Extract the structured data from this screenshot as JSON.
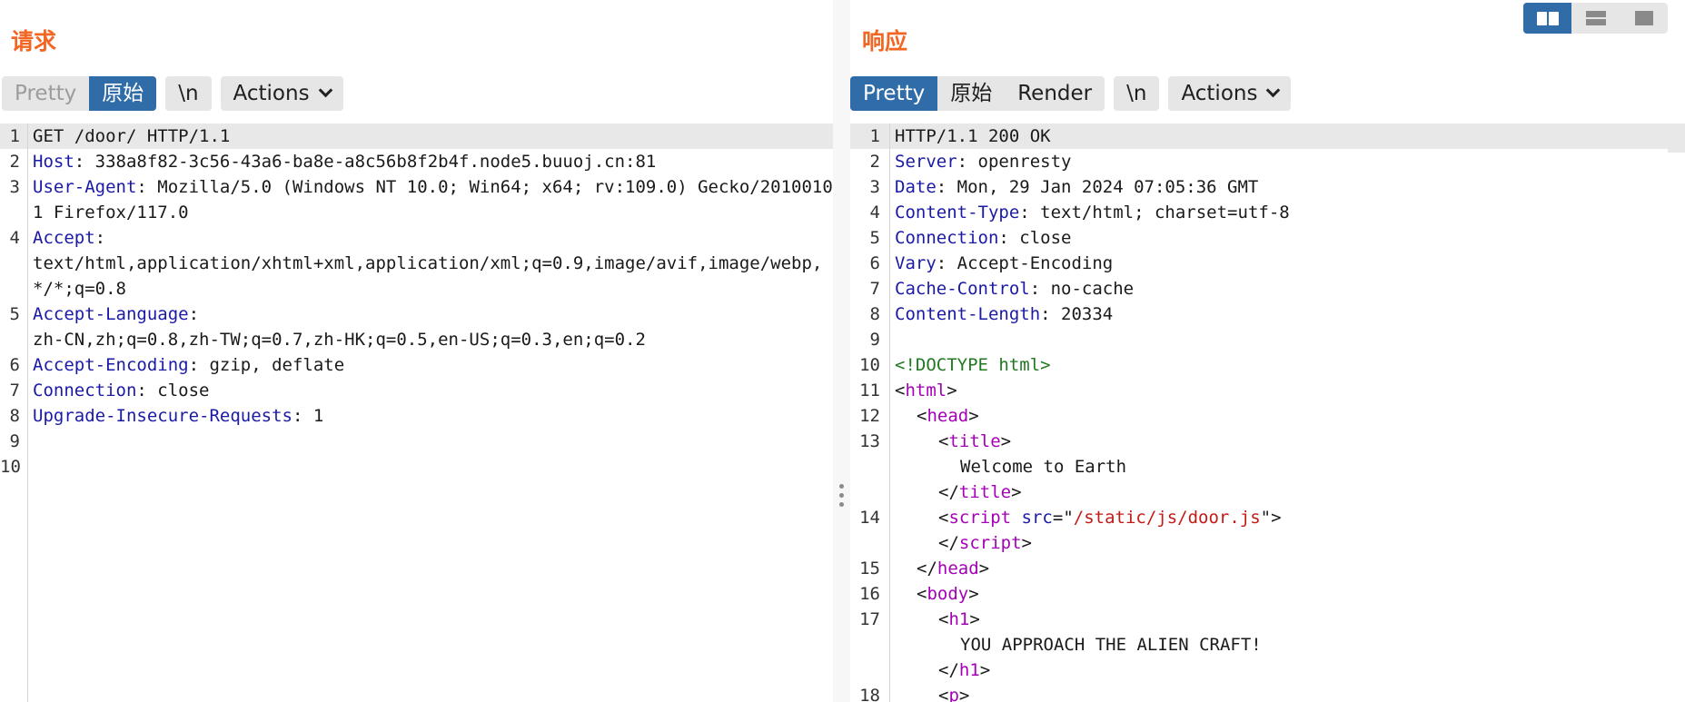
{
  "layout_toggle": {
    "modes": [
      "side-by-side",
      "stacked",
      "single"
    ],
    "active": "side-by-side"
  },
  "request": {
    "title": "请求",
    "tabs": [
      {
        "label": "Pretty",
        "state": "disabled"
      },
      {
        "label": "原始",
        "state": "active"
      }
    ],
    "newline_label": "\\n",
    "actions_label": "Actions",
    "lines": [
      {
        "n": "1",
        "parts": [
          {
            "t": "GET /door/ HTTP/1.1",
            "c": ""
          }
        ]
      },
      {
        "n": "2",
        "parts": [
          {
            "t": "Host",
            "c": "hk"
          },
          {
            "t": ": 338a8f82-3c56-43a6-ba8e-a8c56b8f2b4f.node5.buuoj.cn:81",
            "c": ""
          }
        ]
      },
      {
        "n": "3",
        "parts": [
          {
            "t": "User-Agent",
            "c": "hk"
          },
          {
            "t": ": Mozilla/5.0 (Windows NT 10.0; Win64; x64; rv:109.0) Gecko/20100101 Firefox/117.0",
            "c": ""
          }
        ]
      },
      {
        "n": "4",
        "parts": [
          {
            "t": "Accept",
            "c": "hk"
          },
          {
            "t": ":\ntext/html,application/xhtml+xml,application/xml;q=0.9,image/avif,image/webp,*/*;q=0.8",
            "c": ""
          }
        ]
      },
      {
        "n": "5",
        "parts": [
          {
            "t": "Accept-Language",
            "c": "hk"
          },
          {
            "t": ":\nzh-CN,zh;q=0.8,zh-TW;q=0.7,zh-HK;q=0.5,en-US;q=0.3,en;q=0.2",
            "c": ""
          }
        ]
      },
      {
        "n": "6",
        "parts": [
          {
            "t": "Accept-Encoding",
            "c": "hk"
          },
          {
            "t": ": gzip, deflate",
            "c": ""
          }
        ]
      },
      {
        "n": "7",
        "parts": [
          {
            "t": "Connection",
            "c": "hk"
          },
          {
            "t": ": close",
            "c": ""
          }
        ]
      },
      {
        "n": "8",
        "parts": [
          {
            "t": "Upgrade-Insecure-Requests",
            "c": "hk"
          },
          {
            "t": ": 1",
            "c": ""
          }
        ]
      },
      {
        "n": "9",
        "parts": []
      },
      {
        "n": "10",
        "parts": []
      }
    ]
  },
  "response": {
    "title": "响应",
    "tabs": [
      {
        "label": "Pretty",
        "state": "active"
      },
      {
        "label": "原始",
        "state": ""
      },
      {
        "label": "Render",
        "state": ""
      }
    ],
    "newline_label": "\\n",
    "actions_label": "Actions",
    "lines": [
      {
        "n": "1",
        "ind": 0,
        "parts": [
          {
            "t": "HTTP/1.1 200 OK",
            "c": ""
          }
        ]
      },
      {
        "n": "2",
        "ind": 0,
        "parts": [
          {
            "t": "Server",
            "c": "hk"
          },
          {
            "t": ": openresty",
            "c": ""
          }
        ]
      },
      {
        "n": "3",
        "ind": 0,
        "parts": [
          {
            "t": "Date",
            "c": "hk"
          },
          {
            "t": ": Mon, 29 Jan 2024 07:05:36 GMT",
            "c": ""
          }
        ]
      },
      {
        "n": "4",
        "ind": 0,
        "parts": [
          {
            "t": "Content-Type",
            "c": "hk"
          },
          {
            "t": ": text/html; charset=utf-8",
            "c": ""
          }
        ]
      },
      {
        "n": "5",
        "ind": 0,
        "parts": [
          {
            "t": "Connection",
            "c": "hk"
          },
          {
            "t": ": close",
            "c": ""
          }
        ]
      },
      {
        "n": "6",
        "ind": 0,
        "parts": [
          {
            "t": "Vary",
            "c": "hk"
          },
          {
            "t": ": Accept-Encoding",
            "c": ""
          }
        ]
      },
      {
        "n": "7",
        "ind": 0,
        "parts": [
          {
            "t": "Cache-Control",
            "c": "hk"
          },
          {
            "t": ": no-cache",
            "c": ""
          }
        ]
      },
      {
        "n": "8",
        "ind": 0,
        "parts": [
          {
            "t": "Content-Length",
            "c": "hk"
          },
          {
            "t": ": 20334",
            "c": ""
          }
        ]
      },
      {
        "n": "9",
        "ind": 0,
        "parts": []
      },
      {
        "n": "10",
        "ind": 0,
        "parts": [
          {
            "t": "<!DOCTYPE html>",
            "c": "doctype"
          }
        ]
      },
      {
        "n": "11",
        "ind": 0,
        "parts": [
          {
            "t": "<",
            "c": ""
          },
          {
            "t": "html",
            "c": "tag"
          },
          {
            "t": ">",
            "c": ""
          }
        ]
      },
      {
        "n": "12",
        "ind": 1,
        "parts": [
          {
            "t": "<",
            "c": ""
          },
          {
            "t": "head",
            "c": "tag"
          },
          {
            "t": ">",
            "c": ""
          }
        ]
      },
      {
        "n": "13",
        "ind": 2,
        "parts": [
          {
            "t": "<",
            "c": ""
          },
          {
            "t": "title",
            "c": "tag"
          },
          {
            "t": ">",
            "c": ""
          }
        ]
      },
      {
        "n": "",
        "ind": 3,
        "parts": [
          {
            "t": "Welcome to Earth",
            "c": ""
          }
        ]
      },
      {
        "n": "",
        "ind": 2,
        "parts": [
          {
            "t": "</",
            "c": ""
          },
          {
            "t": "title",
            "c": "tag"
          },
          {
            "t": ">",
            "c": ""
          }
        ]
      },
      {
        "n": "14",
        "ind": 2,
        "parts": [
          {
            "t": "<",
            "c": ""
          },
          {
            "t": "script",
            "c": "tag"
          },
          {
            "t": " ",
            "c": ""
          },
          {
            "t": "src",
            "c": "attr"
          },
          {
            "t": "=\"",
            "c": ""
          },
          {
            "t": "/static/js/door.js",
            "c": "str"
          },
          {
            "t": "\">",
            "c": ""
          }
        ]
      },
      {
        "n": "",
        "ind": 2,
        "parts": [
          {
            "t": "</",
            "c": ""
          },
          {
            "t": "script",
            "c": "tag"
          },
          {
            "t": ">",
            "c": ""
          }
        ]
      },
      {
        "n": "15",
        "ind": 1,
        "parts": [
          {
            "t": "</",
            "c": ""
          },
          {
            "t": "head",
            "c": "tag"
          },
          {
            "t": ">",
            "c": ""
          }
        ]
      },
      {
        "n": "16",
        "ind": 1,
        "parts": [
          {
            "t": "<",
            "c": ""
          },
          {
            "t": "body",
            "c": "tag"
          },
          {
            "t": ">",
            "c": ""
          }
        ]
      },
      {
        "n": "17",
        "ind": 2,
        "parts": [
          {
            "t": "<",
            "c": ""
          },
          {
            "t": "h1",
            "c": "tag"
          },
          {
            "t": ">",
            "c": ""
          }
        ]
      },
      {
        "n": "",
        "ind": 3,
        "parts": [
          {
            "t": "YOU APPROACH THE ALIEN CRAFT!",
            "c": ""
          }
        ]
      },
      {
        "n": "",
        "ind": 2,
        "parts": [
          {
            "t": "</",
            "c": ""
          },
          {
            "t": "h1",
            "c": "tag"
          },
          {
            "t": ">",
            "c": ""
          }
        ]
      },
      {
        "n": "18",
        "ind": 2,
        "parts": [
          {
            "t": "<",
            "c": ""
          },
          {
            "t": "p",
            "c": "tag"
          },
          {
            "t": ">",
            "c": ""
          }
        ]
      }
    ]
  }
}
